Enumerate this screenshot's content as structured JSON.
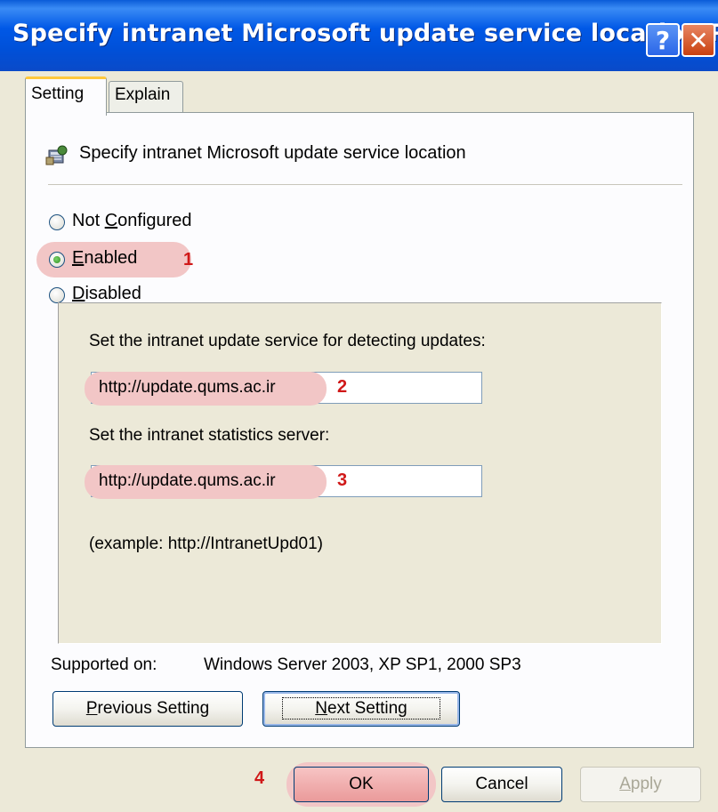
{
  "window": {
    "title": "Specify intranet Microsoft update service location Pr..."
  },
  "titlebar_buttons": {
    "help": "?",
    "close": "✕"
  },
  "tabs": [
    {
      "label": "Setting"
    },
    {
      "label": "Explain"
    }
  ],
  "policy": {
    "name": "Specify intranet Microsoft update service location"
  },
  "radios": {
    "not_configured": {
      "prefix": "Not ",
      "mnemonic": "C",
      "rest": "onfigured"
    },
    "enabled": {
      "mnemonic": "E",
      "rest": "nabled"
    },
    "disabled": {
      "mnemonic": "D",
      "rest": "isabled"
    },
    "selected": "Enabled"
  },
  "options": {
    "update_service_label": "Set the intranet update service for detecting updates:",
    "update_service_value": "http://update.qums.ac.ir",
    "statistics_server_label": "Set the intranet statistics server:",
    "statistics_server_value": "http://update.qums.ac.ir",
    "example": "(example: http://IntranetUpd01)"
  },
  "supported": {
    "label": "Supported on:",
    "value": "Windows Server 2003, XP SP1, 2000 SP3"
  },
  "nav_buttons": {
    "previous": {
      "mnemonic": "P",
      "rest": "revious Setting"
    },
    "next": {
      "mnemonic": "N",
      "rest": "ext Setting"
    }
  },
  "dialog_buttons": {
    "ok": "OK",
    "cancel": "Cancel",
    "apply_mnemonic": "A",
    "apply_rest": "pply"
  },
  "annotations": {
    "m1": "1",
    "m2": "2",
    "m3": "3",
    "m4": "4"
  },
  "colors": {
    "highlight": "#f2c6c6",
    "marker": "#d01818",
    "titlebar": "#0058e6"
  }
}
